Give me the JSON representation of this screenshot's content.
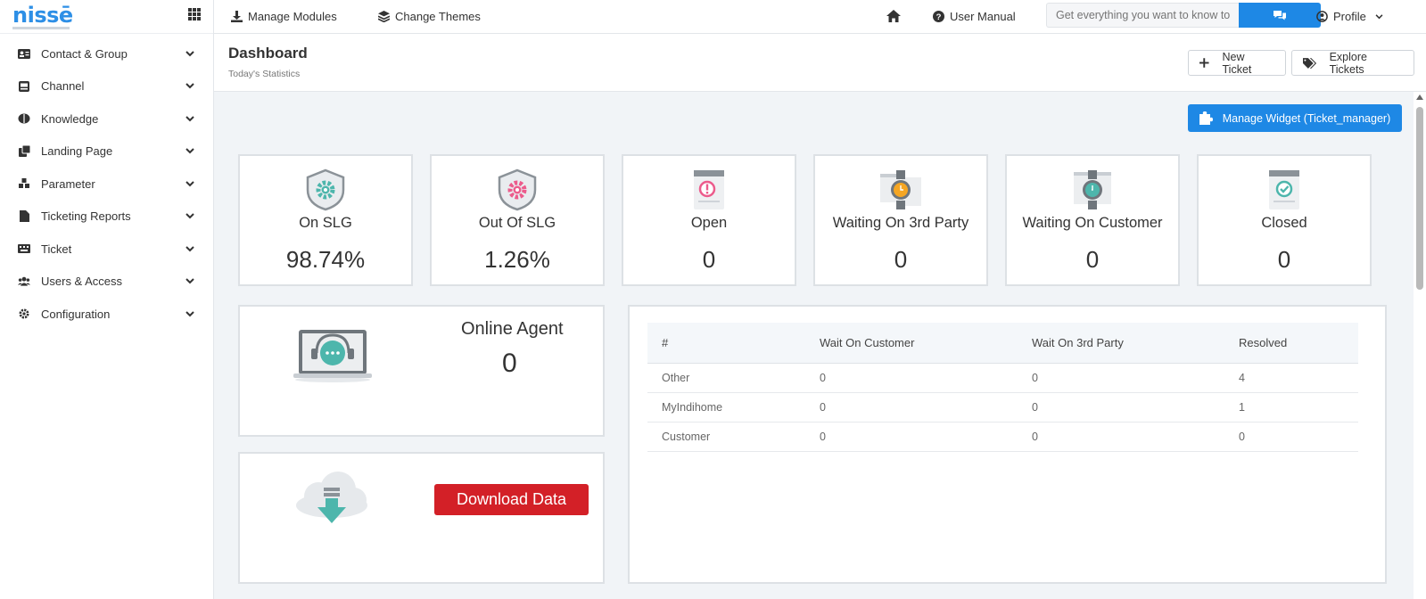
{
  "brand": {
    "name": "nissē"
  },
  "sidebar": {
    "items": [
      {
        "label": "Contact & Group",
        "icon": "id-card-icon"
      },
      {
        "label": "Channel",
        "icon": "inbox-icon"
      },
      {
        "label": "Knowledge",
        "icon": "brain-icon"
      },
      {
        "label": "Landing Page",
        "icon": "clone-icon"
      },
      {
        "label": "Parameter",
        "icon": "cubes-icon"
      },
      {
        "label": "Ticketing Reports",
        "icon": "file-icon"
      },
      {
        "label": "Ticket",
        "icon": "keyboard-icon"
      },
      {
        "label": "Users & Access",
        "icon": "users-icon"
      },
      {
        "label": "Configuration",
        "icon": "gear-icon"
      }
    ]
  },
  "topbar": {
    "manage_modules": "Manage Modules",
    "change_themes": "Change Themes",
    "user_manual": "User Manual",
    "search_placeholder": "Get everything you want to know to",
    "profile": "Profile"
  },
  "header": {
    "title": "Dashboard",
    "subtitle": "Today's Statistics",
    "new_ticket": "New Ticket",
    "explore_tickets": "Explore Tickets"
  },
  "widget": {
    "label": "Manage Widget (Ticket_manager)"
  },
  "stats": [
    {
      "label": "On SLG",
      "value": "98.74%"
    },
    {
      "label": "Out Of SLG",
      "value": "1.26%"
    },
    {
      "label": "Open",
      "value": "0"
    },
    {
      "label": "Waiting On 3rd Party",
      "value": "0"
    },
    {
      "label": "Waiting On Customer",
      "value": "0"
    },
    {
      "label": "Closed",
      "value": "0"
    }
  ],
  "agent": {
    "title": "Online Agent",
    "value": "0"
  },
  "download": {
    "label": "Download Data"
  },
  "table": {
    "headers": [
      "#",
      "Wait On Customer",
      "Wait On 3rd Party",
      "Resolved"
    ],
    "rows": [
      [
        "Other",
        "0",
        "0",
        "4"
      ],
      [
        "MyIndihome",
        "0",
        "0",
        "1"
      ],
      [
        "Customer",
        "0",
        "0",
        "0"
      ]
    ]
  },
  "colors": {
    "accent": "#1e88e5",
    "danger": "#d32027",
    "teal": "#4db6ac",
    "pink": "#ec5c8c"
  }
}
